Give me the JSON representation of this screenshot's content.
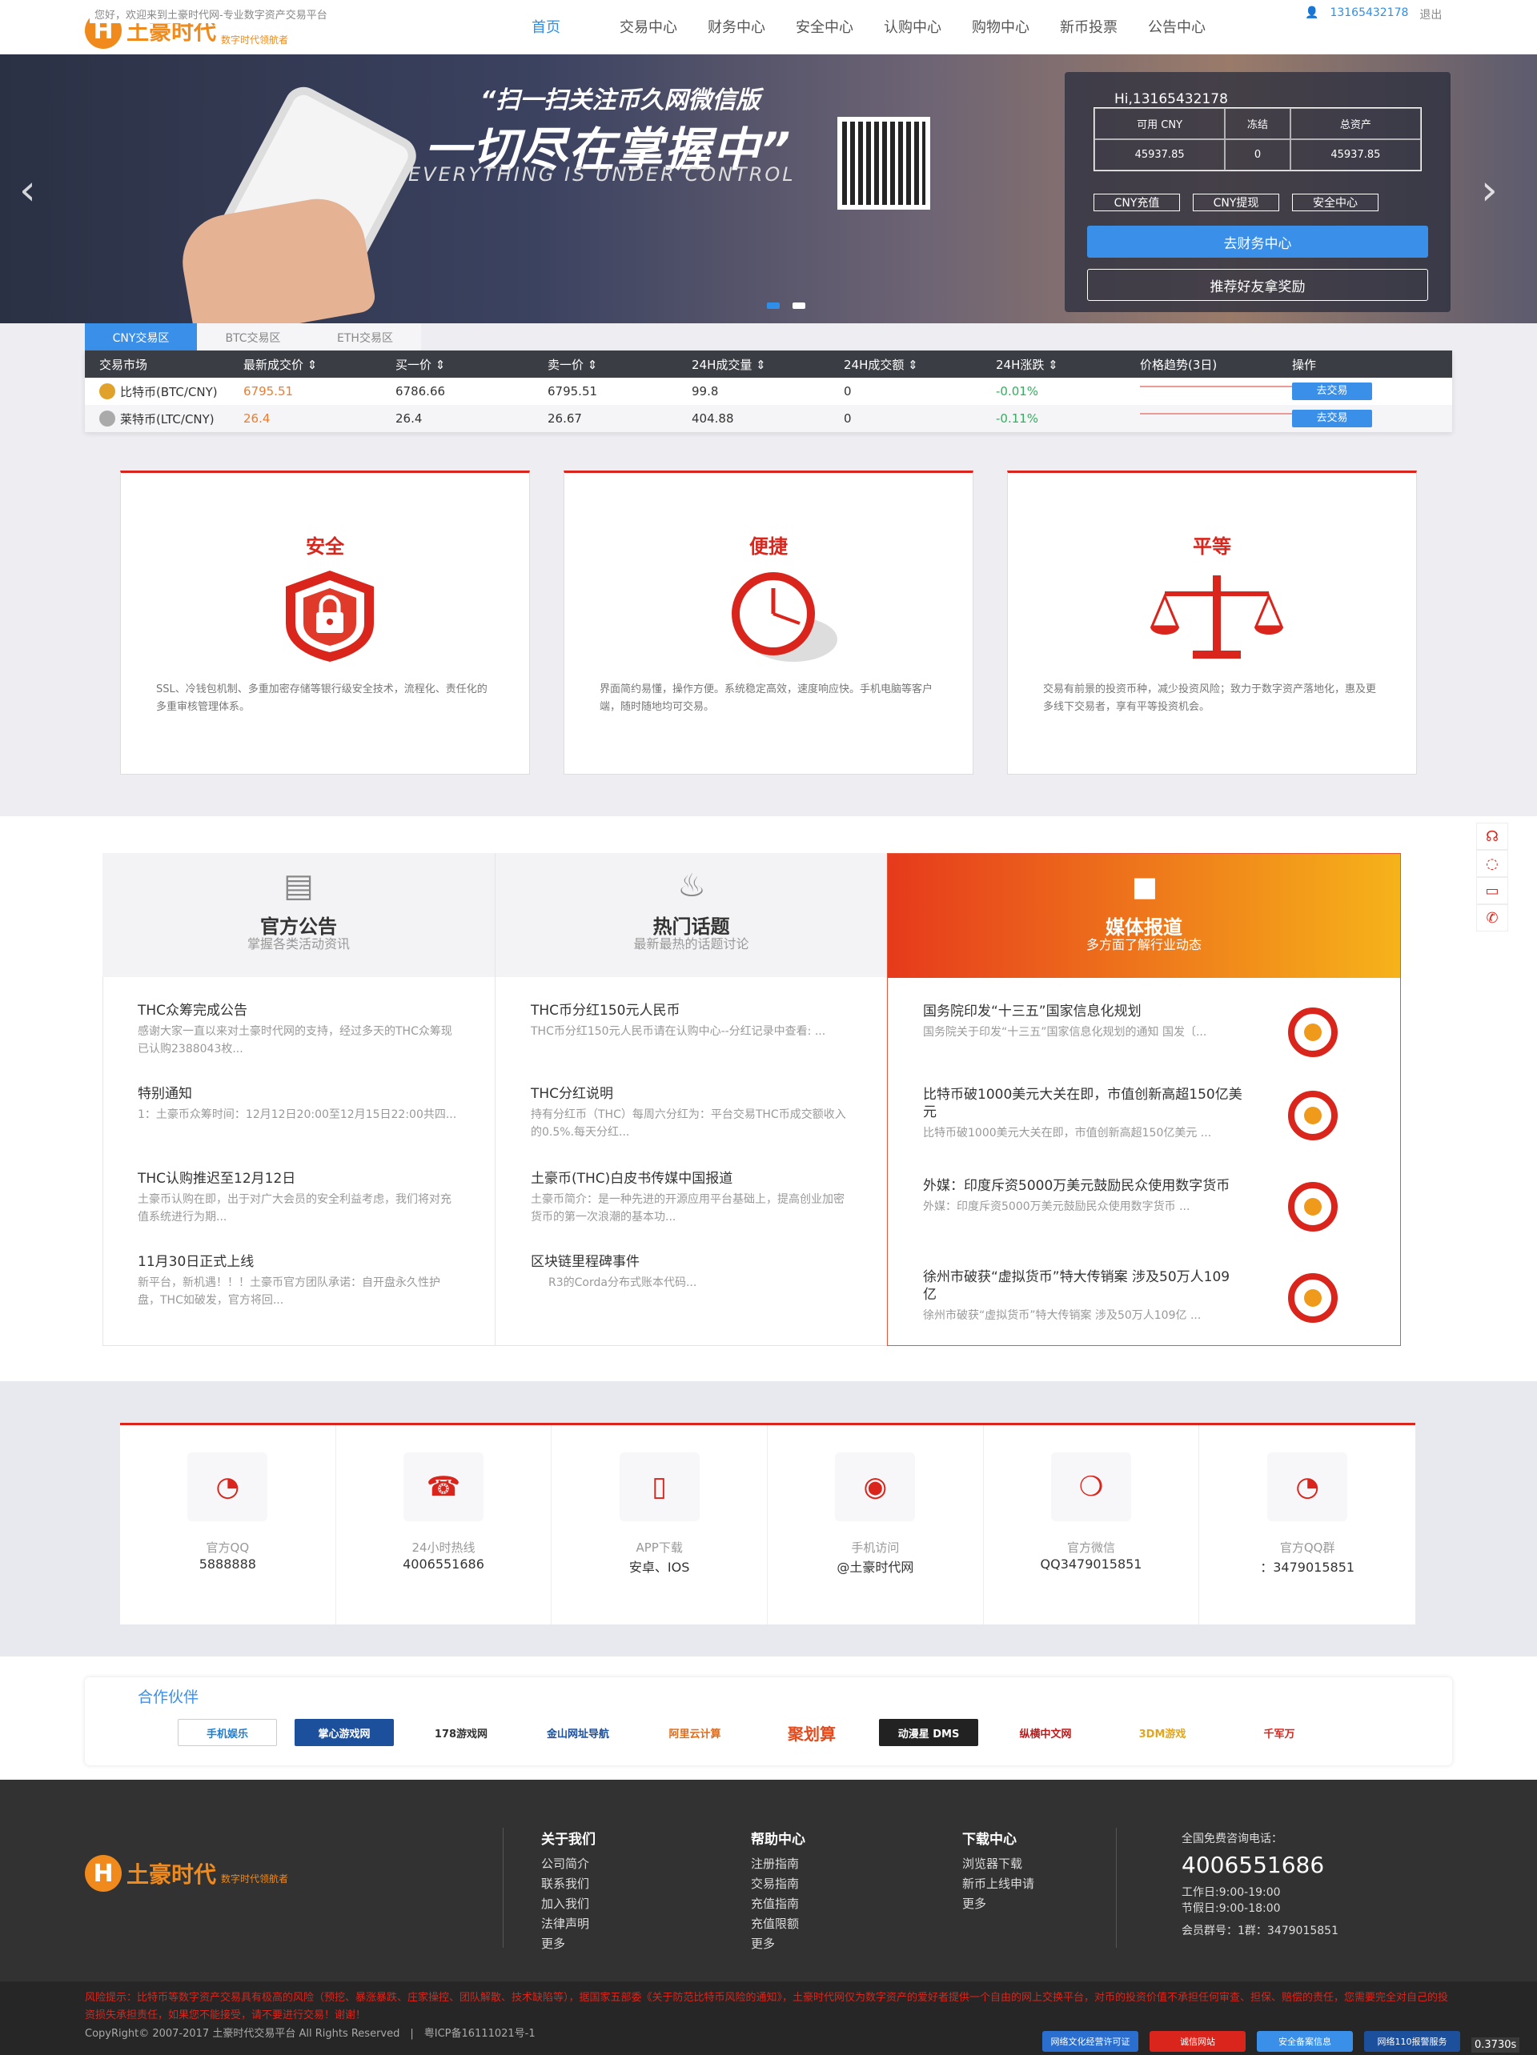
{
  "header": {
    "welcome": "您好，欢迎来到土豪时代网-专业数字资产交易平台",
    "logo_mark": "H",
    "logo_name": "土豪时代",
    "logo_slogan": "数字时代领航者",
    "nav": [
      "首页",
      "交易中心",
      "财务中心",
      "安全中心",
      "认购中心",
      "购物中心",
      "新币投票",
      "公告中心"
    ],
    "nav_active": 0,
    "user_phone": "13165432178",
    "logout": "退出"
  },
  "banner": {
    "line1": "“扫一扫关注币久网微信版",
    "line2": "一切尽在掌握中”",
    "line3": "EVERYTHING IS UNDER CONTROL",
    "prev_icon": "chevron-left-icon",
    "next_icon": "chevron-right-icon"
  },
  "user_panel": {
    "greeting": "Hi,13165432178",
    "headers": [
      "可用 CNY",
      "冻结",
      "总资产"
    ],
    "values": [
      "45937.85",
      "0",
      "45937.85"
    ],
    "btn_recharge": "CNY充值",
    "btn_withdraw": "CNY提现",
    "btn_security": "安全中心",
    "btn_finance": "去财务中心",
    "btn_referral": "推荐好友拿奖励"
  },
  "market": {
    "tabs": [
      "CNY交易区",
      "BTC交易区",
      "ETH交易区"
    ],
    "headers": [
      "交易市场",
      "最新成交价 ⇕",
      "买一价 ⇕",
      "卖一价 ⇕",
      "24H成交量 ⇕",
      "24H成交额 ⇕",
      "24H涨跌 ⇕",
      "价格趋势(3日)",
      "操作"
    ],
    "rows": [
      {
        "market": "比特币(BTC/CNY)",
        "last": "6795.51",
        "buy": "6786.66",
        "sell": "6795.51",
        "vol": "99.8",
        "amount": "0",
        "change": "-0.01%",
        "action": "去交易"
      },
      {
        "market": "莱特币(LTC/CNY)",
        "last": "26.4",
        "buy": "26.4",
        "sell": "26.67",
        "vol": "404.88",
        "amount": "0",
        "change": "-0.11%",
        "action": "去交易"
      }
    ]
  },
  "features": [
    {
      "title": "安全",
      "desc": "SSL、冷钱包机制、多重加密存储等银行级安全技术，流程化、责任化的多重审核管理体系。",
      "icon": "lock-shield-icon"
    },
    {
      "title": "便捷",
      "desc": "界面简约易懂，操作方便。系统稳定高效，速度响应快。手机电脑等客户端，随时随地均可交易。",
      "icon": "clock-icon"
    },
    {
      "title": "平等",
      "desc": "交易有前景的投资币种，减少投资风险；致力于数字资产落地化，惠及更多线下交易者，享有平等投资机会。",
      "icon": "scale-icon"
    }
  ],
  "news": {
    "announce": {
      "title": "官方公告",
      "subtitle": "掌握各类活动资讯",
      "icon": "notice-icon",
      "items": [
        {
          "title": "THC众筹完成公告",
          "desc": "感谢大家一直以来对土豪时代网的支持，经过多天的THC众筹现已认购2388043枚..."
        },
        {
          "title": "特别通知",
          "desc": "1：土豪币众筹时间：12月12日20:00至12月15日22:00共四..."
        },
        {
          "title": "THC认购推迟至12月12日",
          "desc": "土豪币认购在即，出于对广大会员的安全利益考虑，我们将对充值系统进行为期..."
        },
        {
          "title": "11月30日正式上线",
          "desc": "新平台，新机遇！！！土豪币官方团队承诺：自开盘永久性护盘，THC如破发，官方将回..."
        }
      ]
    },
    "hot": {
      "title": "热门话题",
      "subtitle": "最新最热的话题讨论",
      "icon": "flame-icon",
      "items": [
        {
          "title": "THC币分红150元人民币",
          "desc": "THC币分红150元人民币请在认购中心--分红记录中查看: ..."
        },
        {
          "title": "THC分红说明",
          "desc": "持有分红币（THC）每周六分红为：平台交易THC币成交额收入的0.5%.每天分红..."
        },
        {
          "title": "土豪币(THC)白皮书传媒中国报道",
          "desc": "土豪币简介：是一种先进的开源应用平台基础上，提高创业加密货币的第一次浪潮的基本功..."
        },
        {
          "title": "区块链里程碑事件",
          "desc": "R3的Corda分布式账本代码..."
        }
      ]
    },
    "media": {
      "title": "媒体报道",
      "subtitle": "多方面了解行业动态",
      "icon": "camera-icon",
      "items": [
        {
          "title": "国务院印发“十三五”国家信息化规划",
          "desc": "国务院关于印发“十三五”国家信息化规划的通知 国发〔..."
        },
        {
          "title": "比特币破1000美元大关在即，市值创新高超150亿美元",
          "desc": "比特币破1000美元大关在即，市值创新高超150亿美元 ..."
        },
        {
          "title": "外媒：印度斥资5000万美元鼓励民众使用数字货币",
          "desc": "外媒：印度斥资5000万美元鼓励民众使用数字货币 ..."
        },
        {
          "title": "徐州市破获“虚拟货币”特大传销案 涉及50万人109亿",
          "desc": "徐州市破获“虚拟货币”特大传销案 涉及50万人109亿 ..."
        }
      ]
    }
  },
  "contacts": [
    {
      "label": "官方QQ",
      "value": "5888888",
      "icon": "qq-icon"
    },
    {
      "label": "24小时热线",
      "value": "4006551686",
      "icon": "phone-24-icon"
    },
    {
      "label": "APP下载",
      "value": "安卓、IOS",
      "icon": "mobile-icon"
    },
    {
      "label": "手机访问",
      "value": "@土豪时代网",
      "icon": "weibo-icon"
    },
    {
      "label": "官方微信",
      "value": "QQ3479015851",
      "icon": "wechat-icon"
    },
    {
      "label": "官方QQ群",
      "value": "：3479015851",
      "icon": "qq-group-icon"
    }
  ],
  "partners": {
    "title": "合作伙伴",
    "logos": [
      "手机娱乐",
      "掌心游戏网",
      "178游戏网",
      "金山网址导航",
      "阿里云计算",
      "聚划算",
      "动漫星 DMS",
      "纵横中文网",
      "3DM游戏",
      "千军万"
    ]
  },
  "footer": {
    "cols": [
      {
        "title": "关于我们",
        "links": [
          "公司简介",
          "联系我们",
          "加入我们",
          "法律声明",
          "更多"
        ]
      },
      {
        "title": "帮助中心",
        "links": [
          "注册指南",
          "交易指南",
          "充值指南",
          "充值限额",
          "更多"
        ]
      },
      {
        "title": "下载中心",
        "links": [
          "浏览器下载",
          "新币上线申请",
          "更多"
        ]
      }
    ],
    "hotline_label": "全国免费咨询电话：",
    "hotline": "4006551686",
    "workday": "工作日:9:00-19:00",
    "holiday": "节假日:9:00-18:00",
    "group": "会员群号：1群：3479015851",
    "risk": "风险提示：比特币等数字资产交易具有极高的风险（预挖、暴涨暴跌、庄家操控、团队解散、技术缺陷等），据国家五部委《关于防范比特币风险的通知》，土豪时代网仅为数字资产的爱好者提供一个自由的网上交换平台，对币的投资价值不承担任何审查、担保、赔偿的责任，您需要完全对自己的投资损失承担责任，如果您不能接受，请不要进行交易！谢谢！",
    "copyright": "CopyRight© 2007-2017 土豪时代交易平台 All Rights Reserved　|　粤ICP备16111021号-1",
    "badges": [
      "网络文化经营许可证",
      "诚信网站",
      "安全备案信息",
      "网络110报警服务"
    ],
    "timer": "0.3730s"
  },
  "floating": [
    "headset-icon",
    "chat-icon",
    "book-icon",
    "phone-icon"
  ]
}
